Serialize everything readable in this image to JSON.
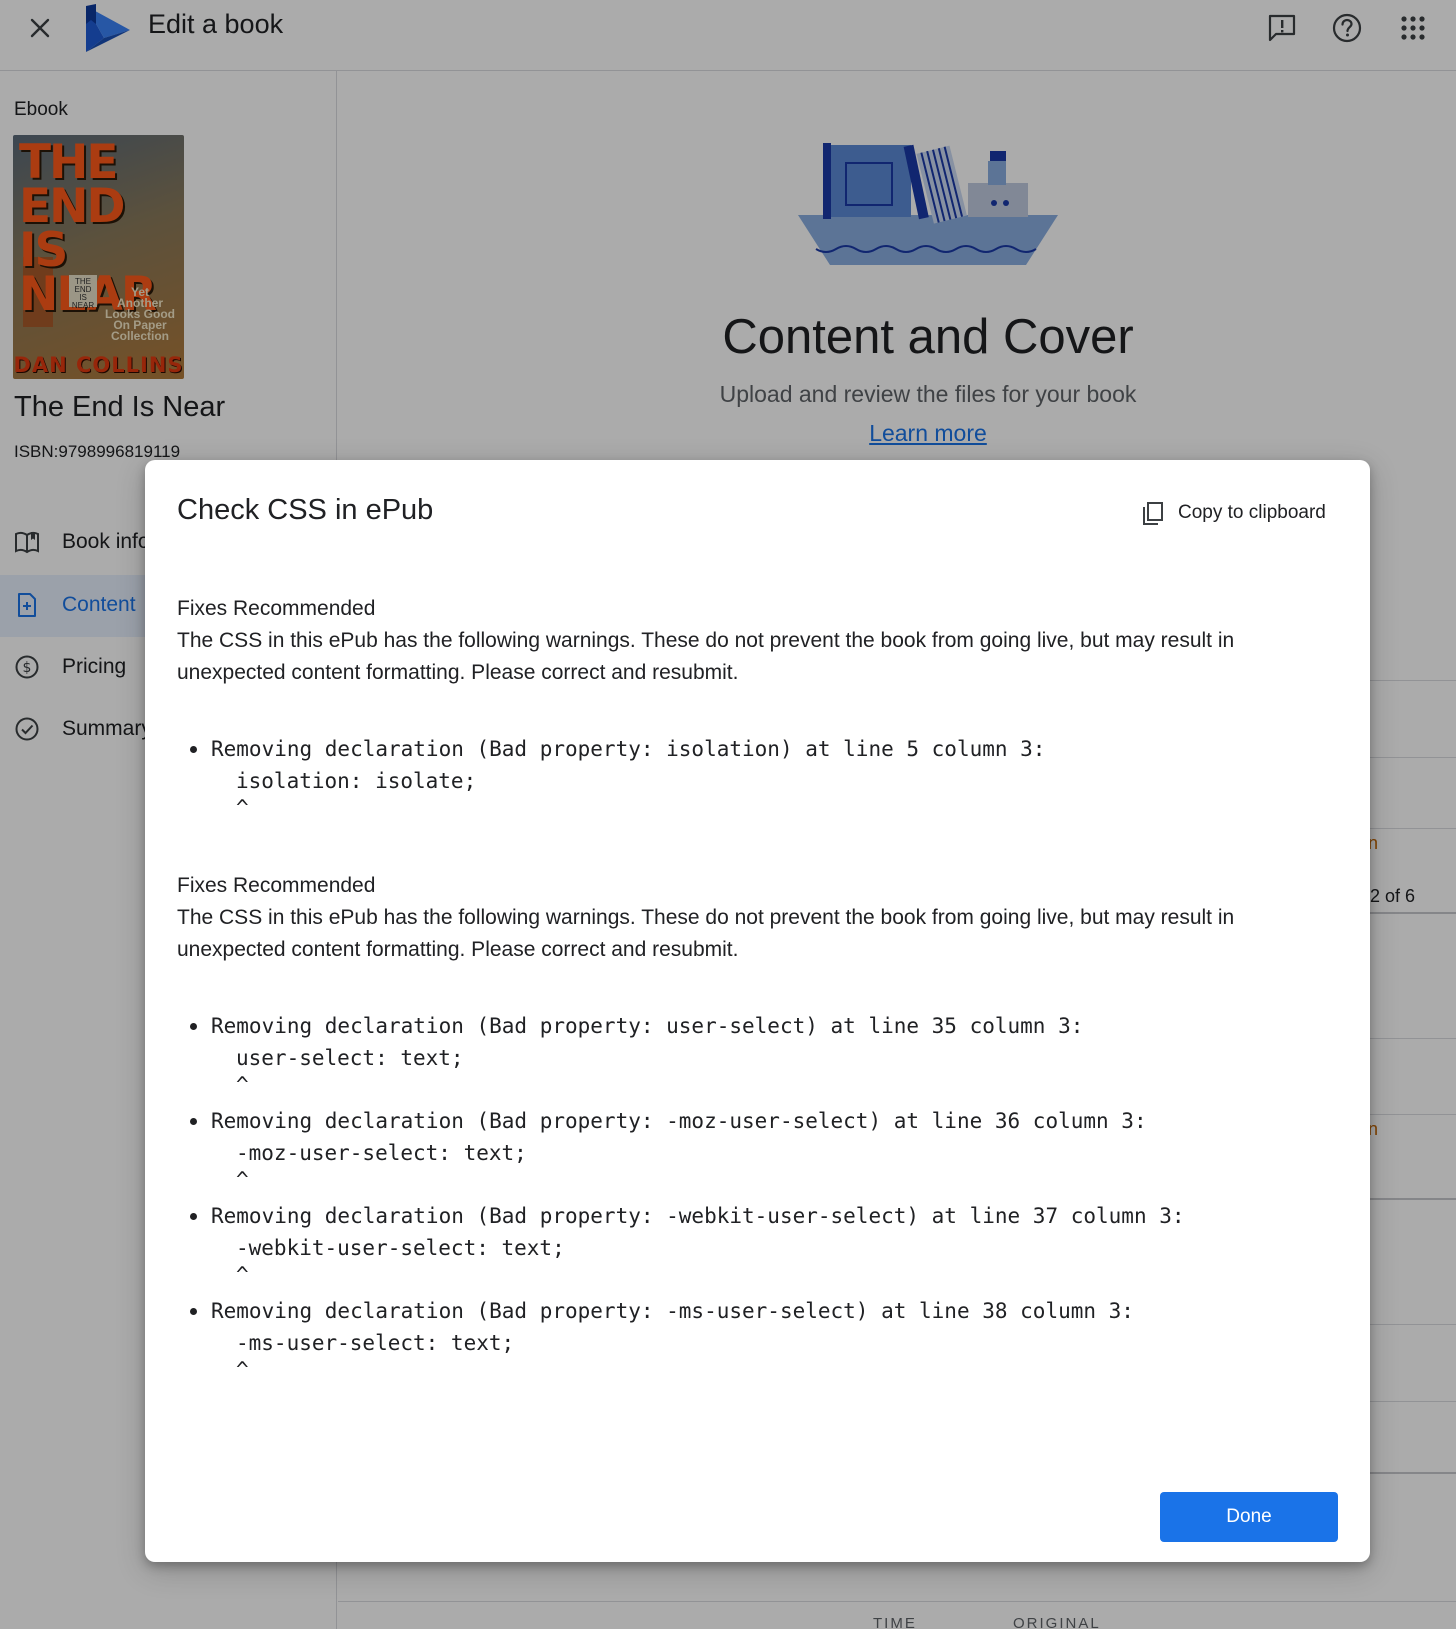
{
  "header": {
    "app_title": "Edit a book"
  },
  "sidebar": {
    "format_label": "Ebook",
    "cover": {
      "title": "THE END\nIS NEAR",
      "subtitle": "Yet\nAnother\nLooks Good\nOn Paper\nCollection",
      "sign": "THE\nEND\nIS\nNEAR",
      "author": "DAN COLLINS"
    },
    "book_title": "The End Is Near",
    "isbn": "ISBN:9798996819119",
    "nav": [
      {
        "label": "Book info",
        "icon": "book-open-icon",
        "active": false
      },
      {
        "label": "Content",
        "icon": "file-add-icon",
        "active": true
      },
      {
        "label": "Pricing",
        "icon": "dollar-circle-icon",
        "active": false
      },
      {
        "label": "Summary",
        "icon": "check-circle-icon",
        "active": false
      }
    ]
  },
  "main": {
    "title": "Content and Cover",
    "subtitle": "Upload and review the files for your book",
    "learn_more": "Learn more",
    "fragments": {
      "page_count": "2 of 6",
      "link_a": "n",
      "link_b": "n"
    },
    "table_headers": [
      "TIME",
      "ORIGINAL"
    ]
  },
  "dialog": {
    "title": "Check CSS in ePub",
    "copy_label": "Copy to clipboard",
    "done_label": "Done",
    "sections": [
      {
        "heading": "Fixes Recommended",
        "body": "The CSS in this ePub has the following warnings. These do not prevent the book from going live, but may result in unexpected content formatting. Please correct and resubmit.",
        "warnings": [
          {
            "message": "Removing declaration (Bad property: isolation) at line 5 column 3:",
            "code": "isolation: isolate;",
            "caret": "^"
          }
        ]
      },
      {
        "heading": "Fixes Recommended",
        "body": "The CSS in this ePub has the following warnings. These do not prevent the book from going live, but may result in unexpected content formatting. Please correct and resubmit.",
        "warnings": [
          {
            "message": "Removing declaration (Bad property: user-select) at line 35 column 3:",
            "code": "user-select: text;",
            "caret": "^"
          },
          {
            "message": "Removing declaration (Bad property: -moz-user-select) at line 36 column 3:",
            "code": "-moz-user-select: text;",
            "caret": "^"
          },
          {
            "message": "Removing declaration (Bad property: -webkit-user-select) at line 37 column 3:",
            "code": "-webkit-user-select: text;",
            "caret": "^"
          },
          {
            "message": "Removing declaration (Bad property: -ms-user-select) at line 38 column 3:",
            "code": "-ms-user-select: text;",
            "caret": "^"
          }
        ]
      }
    ]
  },
  "colors": {
    "accent": "#1a73e8",
    "active_nav_bg": "#e8f0fe",
    "scrim": "#000000"
  }
}
